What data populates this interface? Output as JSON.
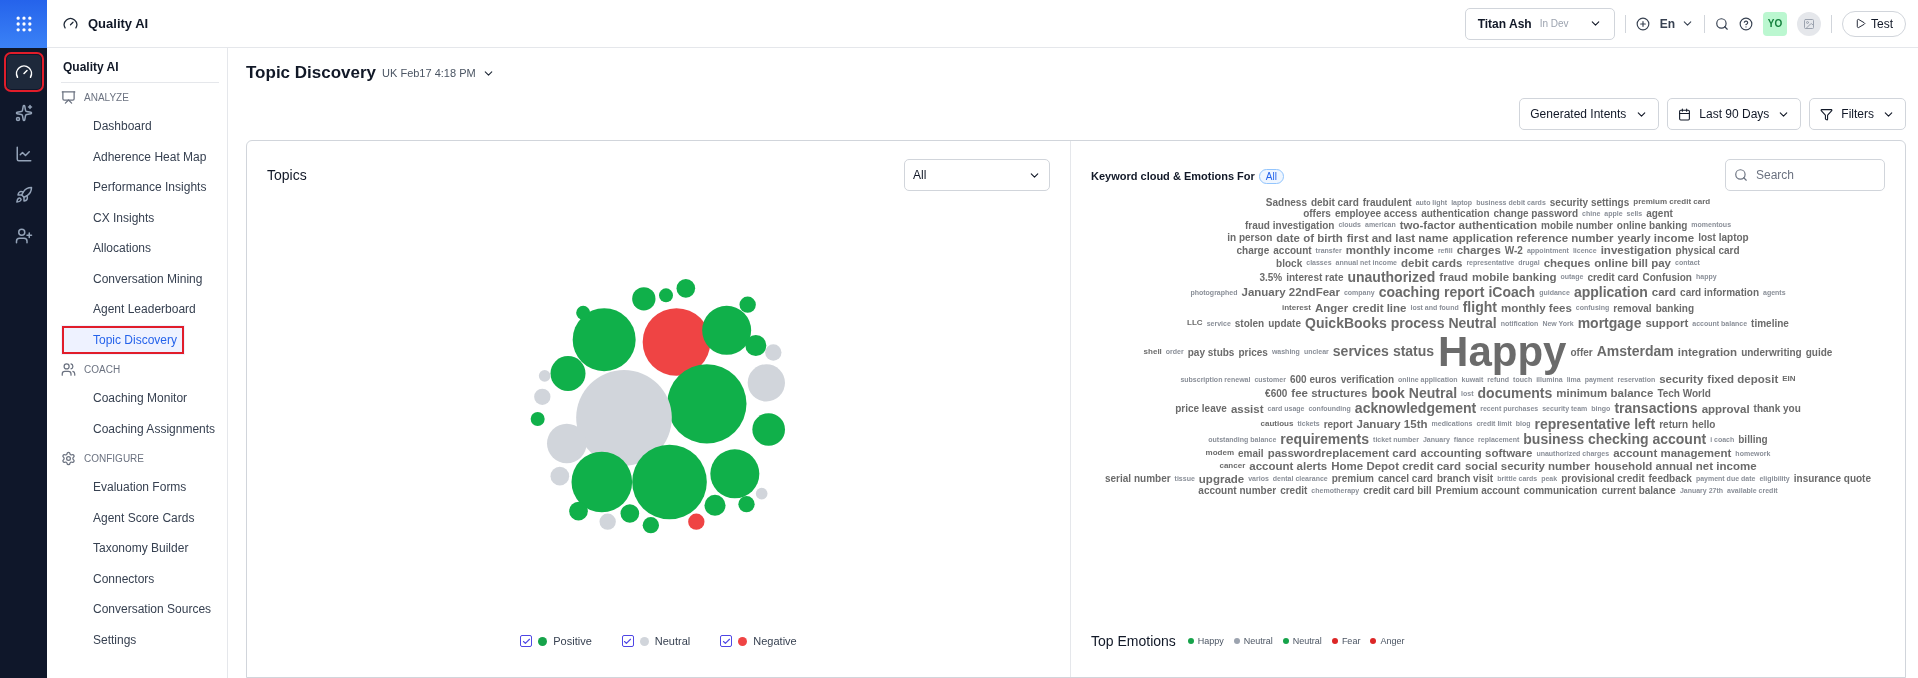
{
  "app": {
    "title": "Quality AI"
  },
  "rail": [
    {
      "kind": "gauge",
      "selected": true,
      "highlighted": true
    },
    {
      "kind": "sparkles",
      "selected": false,
      "highlighted": false
    },
    {
      "kind": "chart",
      "selected": false,
      "highlighted": false
    },
    {
      "kind": "rocket",
      "selected": false,
      "highlighted": false
    },
    {
      "kind": "user-plus",
      "selected": false,
      "highlighted": false
    }
  ],
  "header": {
    "workspace": "Titan Ash",
    "environment": "In Dev",
    "language": "En",
    "avatar": "YO",
    "test_button": "Test"
  },
  "sidebar": {
    "title": "Quality AI",
    "sections": [
      {
        "label": "ANALYZE",
        "kind": "analyze",
        "items": [
          {
            "label": "Dashboard",
            "selected": false,
            "highlighted": false
          },
          {
            "label": "Adherence Heat Map",
            "selected": false,
            "highlighted": false
          },
          {
            "label": "Performance Insights",
            "selected": false,
            "highlighted": false
          },
          {
            "label": "CX Insights",
            "selected": false,
            "highlighted": false
          },
          {
            "label": "Allocations",
            "selected": false,
            "highlighted": false
          },
          {
            "label": "Conversation Mining",
            "selected": false,
            "highlighted": false
          },
          {
            "label": "Agent Leaderboard",
            "selected": false,
            "highlighted": false
          },
          {
            "label": "Topic Discovery",
            "selected": true,
            "highlighted": true
          }
        ]
      },
      {
        "label": "COACH",
        "kind": "coach",
        "items": [
          {
            "label": "Coaching Monitor",
            "selected": false,
            "highlighted": false
          },
          {
            "label": "Coaching Assignments",
            "selected": false,
            "highlighted": false
          }
        ]
      },
      {
        "label": "CONFIGURE",
        "kind": "configure",
        "items": [
          {
            "label": "Evaluation Forms",
            "selected": false,
            "highlighted": false
          },
          {
            "label": "Agent Score Cards",
            "selected": false,
            "highlighted": false
          },
          {
            "label": "Taxonomy Builder",
            "selected": false,
            "highlighted": false
          },
          {
            "label": "Connectors",
            "selected": false,
            "highlighted": false
          },
          {
            "label": "Conversation Sources",
            "selected": false,
            "highlighted": false
          },
          {
            "label": "Settings",
            "selected": false,
            "highlighted": false
          }
        ]
      }
    ]
  },
  "page": {
    "title": "Topic Discovery",
    "subtitle": "UK Feb17 4:18 PM",
    "intent_select": "Generated Intents",
    "date_range": "Last 90 Days",
    "filters_button": "Filters"
  },
  "topics": {
    "title": "Topics",
    "filter": "All",
    "legend": [
      {
        "label": "Positive",
        "color": "#16a34a",
        "checked": true
      },
      {
        "label": "Neutral",
        "color": "#d1d5db",
        "checked": true
      },
      {
        "label": "Negative",
        "color": "#ef4444",
        "checked": true
      }
    ]
  },
  "keywords": {
    "title": "Keyword cloud & Emotions For",
    "badge": "All",
    "search_placeholder": "Search",
    "cloud": [
      [
        {
          "text": "Sadness",
          "kind": "medium"
        },
        {
          "text": "debit card",
          "kind": "medium"
        },
        {
          "text": "fraudulent",
          "kind": "medium"
        },
        {
          "text": "auto light",
          "kind": "tiny"
        },
        {
          "text": "laptop",
          "kind": "tiny"
        },
        {
          "text": "business debit cards",
          "kind": "tiny"
        },
        {
          "text": "security settings",
          "kind": "medium"
        },
        {
          "text": "premium credit card",
          "kind": "small"
        }
      ],
      [
        {
          "text": "offers",
          "kind": "medium"
        },
        {
          "text": "employee access",
          "kind": "medium"
        },
        {
          "text": "authentication",
          "kind": "medium"
        },
        {
          "text": "change password",
          "kind": "medium"
        },
        {
          "text": "chine",
          "kind": "tiny"
        },
        {
          "text": "apple",
          "kind": "tiny"
        },
        {
          "text": "sells",
          "kind": "tiny"
        },
        {
          "text": "agent",
          "kind": "medium"
        }
      ],
      [
        {
          "text": "fraud investigation",
          "kind": "medium"
        },
        {
          "text": "clouds",
          "kind": "tiny"
        },
        {
          "text": "american",
          "kind": "tiny"
        },
        {
          "text": "two-factor authentication",
          "kind": "large"
        },
        {
          "text": "mobile number",
          "kind": "medium"
        },
        {
          "text": "online banking",
          "kind": "medium"
        },
        {
          "text": "momentous",
          "kind": "tiny"
        }
      ],
      [
        {
          "text": "in person",
          "kind": "medium"
        },
        {
          "text": "date of birth",
          "kind": "large"
        },
        {
          "text": "first and last name",
          "kind": "large"
        },
        {
          "text": "application reference number",
          "kind": "large"
        },
        {
          "text": "yearly income",
          "kind": "large"
        },
        {
          "text": "lost laptop",
          "kind": "medium"
        }
      ],
      [
        {
          "text": "charge",
          "kind": "medium"
        },
        {
          "text": "account",
          "kind": "medium"
        },
        {
          "text": "transfer",
          "kind": "tiny"
        },
        {
          "text": "monthly income",
          "kind": "large"
        },
        {
          "text": "refill",
          "kind": "tiny"
        },
        {
          "text": "charges",
          "kind": "large"
        },
        {
          "text": "W-2",
          "kind": "medium"
        },
        {
          "text": "appointment",
          "kind": "tiny"
        },
        {
          "text": "licence",
          "kind": "tiny"
        },
        {
          "text": "investigation",
          "kind": "large"
        },
        {
          "text": "physical card",
          "kind": "medium"
        }
      ],
      [
        {
          "text": "block",
          "kind": "medium"
        },
        {
          "text": "classes",
          "kind": "tiny"
        },
        {
          "text": "annual net income",
          "kind": "tiny"
        },
        {
          "text": "debit cards",
          "kind": "large"
        },
        {
          "text": "representative",
          "kind": "tiny"
        },
        {
          "text": "drugal",
          "kind": "tiny"
        },
        {
          "text": "cheques",
          "kind": "large"
        },
        {
          "text": "online bill pay",
          "kind": "large"
        },
        {
          "text": "contact",
          "kind": "tiny"
        }
      ],
      [
        {
          "text": "3.5%",
          "kind": "medium"
        },
        {
          "text": "interest rate",
          "kind": "medium"
        },
        {
          "text": "unauthorized",
          "kind": "big"
        },
        {
          "text": "fraud",
          "kind": "large"
        },
        {
          "text": "mobile banking",
          "kind": "large"
        },
        {
          "text": "outage",
          "kind": "tiny"
        },
        {
          "text": "credit card",
          "kind": "medium"
        },
        {
          "text": "Confusion",
          "kind": "medium"
        },
        {
          "text": "happy",
          "kind": "tiny"
        }
      ],
      [
        {
          "text": "photographed",
          "kind": "tiny"
        },
        {
          "text": "January 22ndFear",
          "kind": "large"
        },
        {
          "text": "company",
          "kind": "tiny"
        },
        {
          "text": "coaching report",
          "kind": "big"
        },
        {
          "text": "iCoach",
          "kind": "big"
        },
        {
          "text": "guidance",
          "kind": "tiny"
        },
        {
          "text": "application",
          "kind": "big"
        },
        {
          "text": "card",
          "kind": "large"
        },
        {
          "text": "card information",
          "kind": "medium"
        },
        {
          "text": "agents",
          "kind": "tiny"
        }
      ],
      [
        {
          "text": "interest",
          "kind": "small"
        },
        {
          "text": "Anger",
          "kind": "large"
        },
        {
          "text": "credit line",
          "kind": "large"
        },
        {
          "text": "lost and found",
          "kind": "tiny"
        },
        {
          "text": "flight",
          "kind": "big"
        },
        {
          "text": "monthly fees",
          "kind": "large"
        },
        {
          "text": "confusing",
          "kind": "tiny"
        },
        {
          "text": "removal",
          "kind": "medium"
        },
        {
          "text": "banking",
          "kind": "medium"
        }
      ],
      [
        {
          "text": "LLC",
          "kind": "small"
        },
        {
          "text": "service",
          "kind": "tiny"
        },
        {
          "text": "stolen",
          "kind": "medium"
        },
        {
          "text": "update",
          "kind": "medium"
        },
        {
          "text": "QuickBooks",
          "kind": "big"
        },
        {
          "text": "process",
          "kind": "big"
        },
        {
          "text": "Neutral",
          "kind": "big"
        },
        {
          "text": "notification",
          "kind": "tiny"
        },
        {
          "text": "New York",
          "kind": "tiny"
        },
        {
          "text": "mortgage",
          "kind": "big"
        },
        {
          "text": "support",
          "kind": "large"
        },
        {
          "text": "account balance",
          "kind": "tiny"
        },
        {
          "text": "timeline",
          "kind": "medium"
        }
      ],
      [
        {
          "text": "shell",
          "kind": "small"
        },
        {
          "text": "order",
          "kind": "tiny"
        },
        {
          "text": "pay stubs",
          "kind": "medium"
        },
        {
          "text": "prices",
          "kind": "medium"
        },
        {
          "text": "washing",
          "kind": "tiny"
        },
        {
          "text": "unclear",
          "kind": "tiny"
        },
        {
          "text": "services",
          "kind": "big"
        },
        {
          "text": "status",
          "kind": "big"
        },
        {
          "text": "Happy",
          "kind": "huge"
        },
        {
          "text": "offer",
          "kind": "medium"
        },
        {
          "text": "Amsterdam",
          "kind": "big"
        },
        {
          "text": "integration",
          "kind": "large"
        },
        {
          "text": "underwriting",
          "kind": "medium"
        },
        {
          "text": "guide",
          "kind": "medium"
        }
      ],
      [
        {
          "text": "subscription renewal",
          "kind": "tiny"
        },
        {
          "text": "customer",
          "kind": "tiny"
        },
        {
          "text": "600 euros",
          "kind": "medium"
        },
        {
          "text": "verification",
          "kind": "medium"
        },
        {
          "text": "online application",
          "kind": "tiny"
        },
        {
          "text": "kuwait",
          "kind": "tiny"
        },
        {
          "text": "refund",
          "kind": "tiny"
        },
        {
          "text": "touch",
          "kind": "tiny"
        },
        {
          "text": "illumina",
          "kind": "tiny"
        },
        {
          "text": "lima",
          "kind": "tiny"
        },
        {
          "text": "payment",
          "kind": "tiny"
        },
        {
          "text": "reservation",
          "kind": "tiny"
        },
        {
          "text": "security",
          "kind": "large"
        },
        {
          "text": "fixed deposit",
          "kind": "large"
        },
        {
          "text": "EIN",
          "kind": "small"
        }
      ],
      [
        {
          "text": "€600",
          "kind": "medium"
        },
        {
          "text": "fee structures",
          "kind": "large"
        },
        {
          "text": "book",
          "kind": "big"
        },
        {
          "text": "Neutral",
          "kind": "big"
        },
        {
          "text": "lost",
          "kind": "tiny"
        },
        {
          "text": "documents",
          "kind": "big"
        },
        {
          "text": "minimum balance",
          "kind": "large"
        },
        {
          "text": "Tech World",
          "kind": "medium"
        }
      ],
      [
        {
          "text": "price leave",
          "kind": "medium"
        },
        {
          "text": "assist",
          "kind": "large"
        },
        {
          "text": "card usage",
          "kind": "tiny"
        },
        {
          "text": "confounding",
          "kind": "tiny"
        },
        {
          "text": "acknowledgement",
          "kind": "big"
        },
        {
          "text": "recent purchases",
          "kind": "tiny"
        },
        {
          "text": "security team",
          "kind": "tiny"
        },
        {
          "text": "bingo",
          "kind": "tiny"
        },
        {
          "text": "transactions",
          "kind": "big"
        },
        {
          "text": "approval",
          "kind": "large"
        },
        {
          "text": "thank you",
          "kind": "medium"
        }
      ],
      [
        {
          "text": "cautious",
          "kind": "small"
        },
        {
          "text": "tickets",
          "kind": "tiny"
        },
        {
          "text": "report",
          "kind": "medium"
        },
        {
          "text": "January 15th",
          "kind": "large"
        },
        {
          "text": "medications",
          "kind": "tiny"
        },
        {
          "text": "credit limit",
          "kind": "tiny"
        },
        {
          "text": "blog",
          "kind": "tiny"
        },
        {
          "text": "representative left",
          "kind": "big"
        },
        {
          "text": "return",
          "kind": "medium"
        },
        {
          "text": "hello",
          "kind": "medium"
        }
      ],
      [
        {
          "text": "outstanding balance",
          "kind": "tiny"
        },
        {
          "text": "requirements",
          "kind": "big"
        },
        {
          "text": "ticket number",
          "kind": "tiny"
        },
        {
          "text": "January",
          "kind": "tiny"
        },
        {
          "text": "fiance",
          "kind": "tiny"
        },
        {
          "text": "replacement",
          "kind": "tiny"
        },
        {
          "text": "business checking account",
          "kind": "big"
        },
        {
          "text": "i coach",
          "kind": "tiny"
        },
        {
          "text": "billing",
          "kind": "medium"
        }
      ],
      [
        {
          "text": "modem",
          "kind": "small"
        },
        {
          "text": "email",
          "kind": "medium"
        },
        {
          "text": "passwordreplacement card",
          "kind": "large"
        },
        {
          "text": "accounting software",
          "kind": "large"
        },
        {
          "text": "unauthorized charges",
          "kind": "tiny"
        },
        {
          "text": "account management",
          "kind": "large"
        },
        {
          "text": "homework",
          "kind": "tiny"
        }
      ],
      [
        {
          "text": "cancer",
          "kind": "small"
        },
        {
          "text": "account alerts",
          "kind": "large"
        },
        {
          "text": "Home Depot credit card",
          "kind": "large"
        },
        {
          "text": "social security number",
          "kind": "large"
        },
        {
          "text": "household annual net income",
          "kind": "large"
        }
      ],
      [
        {
          "text": "serial number",
          "kind": "medium"
        },
        {
          "text": "tissue",
          "kind": "tiny"
        },
        {
          "text": "upgrade",
          "kind": "large"
        },
        {
          "text": "varios",
          "kind": "tiny"
        },
        {
          "text": "dental clearance",
          "kind": "tiny"
        },
        {
          "text": "premium",
          "kind": "medium"
        },
        {
          "text": "cancel card",
          "kind": "medium"
        },
        {
          "text": "branch visit",
          "kind": "medium"
        },
        {
          "text": "brittle cards",
          "kind": "tiny"
        },
        {
          "text": "peak",
          "kind": "tiny"
        },
        {
          "text": "provisional credit",
          "kind": "medium"
        },
        {
          "text": "feedback",
          "kind": "medium"
        },
        {
          "text": "payment due date",
          "kind": "tiny"
        },
        {
          "text": "eligibility",
          "kind": "tiny"
        },
        {
          "text": "insurance quote",
          "kind": "medium"
        }
      ],
      [
        {
          "text": "account number",
          "kind": "medium"
        },
        {
          "text": "credit",
          "kind": "medium"
        },
        {
          "text": "chemotherapy",
          "kind": "tiny"
        },
        {
          "text": "credit card bill",
          "kind": "medium"
        },
        {
          "text": "Premium account",
          "kind": "medium"
        },
        {
          "text": "communication",
          "kind": "medium"
        },
        {
          "text": "current balance",
          "kind": "medium"
        },
        {
          "text": "January 27th",
          "kind": "tiny"
        },
        {
          "text": "available credit",
          "kind": "tiny"
        }
      ]
    ],
    "emotions_title": "Top Emotions",
    "emotions": [
      {
        "label": "Happy",
        "color": "#16a34a"
      },
      {
        "label": "Neutral",
        "color": "#9ca3af"
      },
      {
        "label": "Neutral",
        "color": "#16a34a"
      },
      {
        "label": "Fear",
        "color": "#dc2626"
      },
      {
        "label": "Anger",
        "color": "#dc2626"
      }
    ]
  }
}
